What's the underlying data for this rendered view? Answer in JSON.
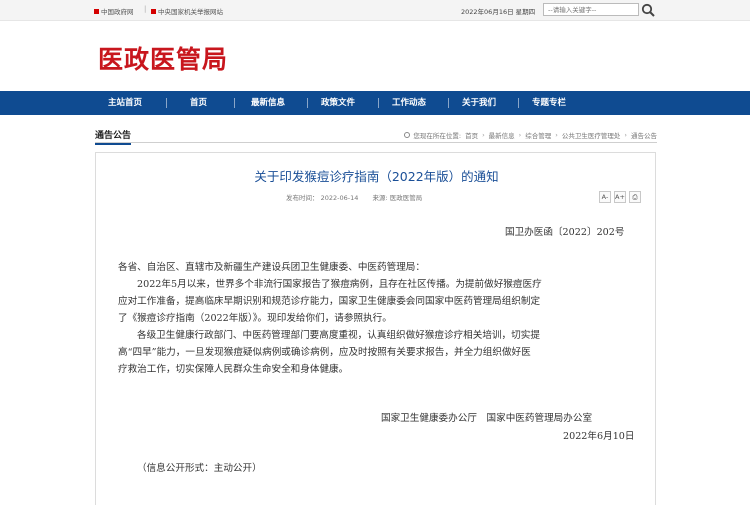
{
  "topbar": {
    "links": [
      "中国政府网",
      "中央国家机关举报网站"
    ],
    "separator": "|",
    "date": "2022年06月16日 星期四",
    "search_placeholder": "--请输入关键字--"
  },
  "site": {
    "logo_text": "医政医管局"
  },
  "nav": {
    "items": [
      "主站首页",
      "首页",
      "最新信息",
      "政策文件",
      "工作动态",
      "关于我们",
      "专题专栏"
    ],
    "separator": "|"
  },
  "section": {
    "title": "通告公告"
  },
  "breadcrumb": {
    "prefix": "您现在所在位置:",
    "items": [
      "首页",
      "最新信息",
      "综合管理",
      "公共卫生医疗管理处",
      "通告公告"
    ],
    "arrow": "›"
  },
  "article": {
    "title": "关于印发猴痘诊疗指南（2022年版）的通知",
    "publish_label": "发布时间：",
    "publish_date": "2022-06-14",
    "source_label": "来源:",
    "source": "医政医管局",
    "tools": [
      "A-",
      "A+",
      "⎙"
    ],
    "doc_number": "国卫办医函〔2022〕202号",
    "lines": [
      "各省、自治区、直辖市及新疆生产建设兵团卫生健康委、中医药管理局：",
      "2022年5月以来，世界多个非流行国家报告了猴痘病例，且存在社区传播。为提前做好猴痘医疗",
      "应对工作准备，提高临床早期识别和规范诊疗能力，国家卫生健康委会同国家中医药管理局组织制定",
      "了《猴痘诊疗指南（2022年版）》。现印发给你们，请参照执行。",
      "各级卫生健康行政部门、中医药管理部门要高度重视，认真组织做好猴痘诊疗相关培训，切实提",
      "高“四早”能力，一旦发现猴痘疑似病例或确诊病例，应及时按照有关要求报告，并全力组织做好医",
      "疗救治工作，切实保障人民群众生命安全和身体健康。"
    ],
    "signature": "国家卫生健康委办公厅　国家中医药管理局办公室",
    "sign_date": "2022年6月10日",
    "disclosure": "（信息公开形式：主动公开）"
  }
}
